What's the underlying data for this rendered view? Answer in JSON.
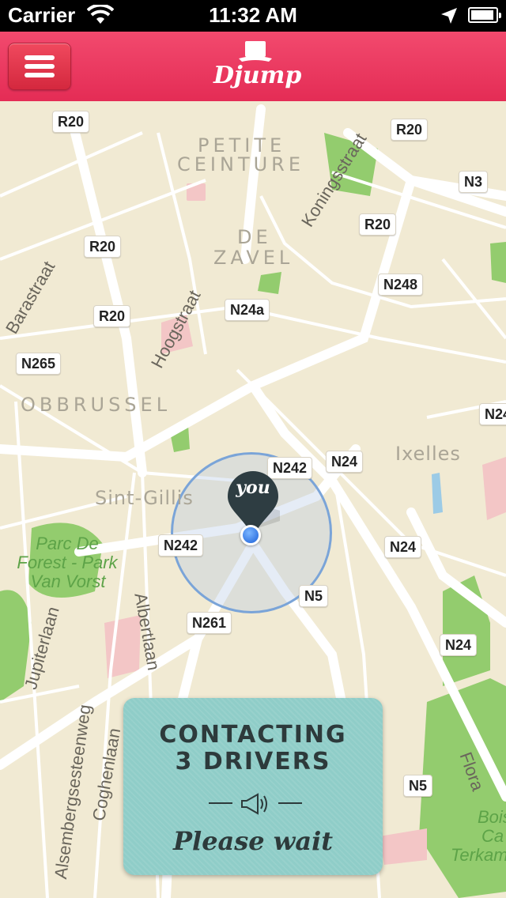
{
  "status_bar": {
    "carrier": "Carrier",
    "time": "11:32 AM"
  },
  "navbar": {
    "logo": "Djump"
  },
  "map": {
    "road_labels": [
      "R20",
      "R20",
      "N3",
      "R20",
      "R20",
      "N248",
      "N24a",
      "R20",
      "N265",
      "N24",
      "N242",
      "N24",
      "N242",
      "N24",
      "N5",
      "N261",
      "N24",
      "N5"
    ],
    "districts": [
      "PETITE",
      "CEINTURE",
      "DE",
      "ZAVEL",
      "OBBRUSSEL",
      "Sint-Gillis",
      "Ixelles"
    ],
    "streets": [
      "Koningsstraat",
      "Hoogstraat",
      "Barastraat",
      "Jupiterlaan",
      "Albertlaan",
      "Alsembergsesteenweg",
      "Coghenlaan",
      "Flora"
    ],
    "parks": [
      "Parc De",
      "Forest - Park",
      "Van Vorst",
      "Bois",
      "Ca",
      "Terkam"
    ],
    "pin_label": "you"
  },
  "contact_panel": {
    "title_line1": "CONTACTING",
    "title_line2": "3 DRIVERS",
    "message": "Please wait"
  },
  "colors": {
    "navbar": "#e8335b",
    "panel": "#8fcdc8",
    "map_bg": "#f1ead3",
    "park": "#93cc6e"
  }
}
